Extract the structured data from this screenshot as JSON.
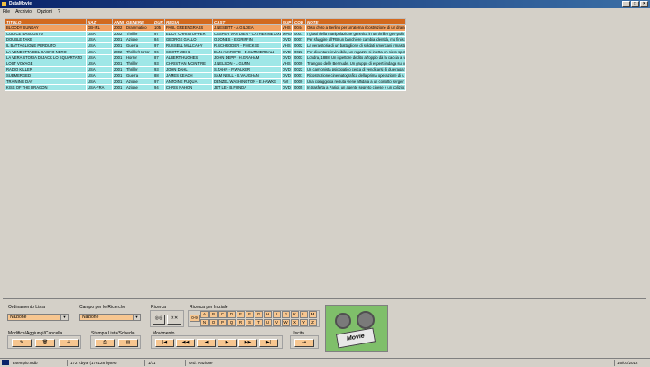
{
  "window": {
    "title": "DataMovie"
  },
  "menu": [
    "File",
    "Archivio",
    "Opzioni",
    "?"
  ],
  "grid": {
    "columns": [
      "TITOLO",
      "NAZ",
      "ANNI",
      "GENERE",
      "DUR",
      "REGIA",
      "CAST",
      "SUP",
      "COD",
      "NOTE"
    ],
    "rows": [
      [
        "BLOODY SUNDAY",
        "GB-IRL",
        "2002",
        "Drammatico",
        "105",
        "PAUL GREENGRASS",
        "J.NESBITT - A.GILDEA",
        "VHS",
        "0044",
        "Orso d'oro a Berlino per un'aterna ricostruzione di un dram"
      ],
      [
        "CODICE NASCOSTO",
        "USA",
        "2002",
        "Thriller",
        "97",
        "ELIOT CHRISTOPHER",
        "CASPER VAN DIEN - CATHERINE OXE",
        "MPEG",
        "0001",
        "I giusti della manipolazione genetica in un thriller geo-politi"
      ],
      [
        "DOUBLE TAKE",
        "USA",
        "2001",
        "Azione",
        "84",
        "GEORGE GALLO",
        "O.JONES - E.GRIFFIN",
        "DVD",
        "0007",
        "Per sfuggire all'FBI un banchiere cambia identità, ma finisco"
      ],
      [
        "IL BATTAGLIONE PERDUTO",
        "USA",
        "2001",
        "Guerra",
        "97",
        "RUSSELL MULCAHY",
        "R.SCHRODER - P.MCKEE",
        "VHS",
        "0002",
        "La vera storia di un battaglione di soldati americani rimasto"
      ],
      [
        "LA VENDETTA DEL RAGNO NERO",
        "USA",
        "2002",
        "Thriller/Horror",
        "96",
        "SCOTT ZIEHL",
        "DAN AYKROYD - D.SUMMERGALL",
        "DVD",
        "0022",
        "Per diventare invincibile, un ragazzo si inietta un siero speri"
      ],
      [
        "LA VERA STORIA DI JACK LO SQUARTATO",
        "USA",
        "2001",
        "Horror",
        "87",
        "ALBERT HUGHES",
        "JOHN DEPP - H.GRAHAM",
        "DVD",
        "0003",
        "Londra, 1888. Un ispettore dedito all'oppio dà la caccia a un"
      ],
      [
        "LOST VOYAGE",
        "USA",
        "2001",
        "Thriller",
        "93",
        "CHRISTIAN MCINTIRE",
        "J.NELSON - J.GUNN",
        "VHS",
        "0009",
        "Triangolo delle Bermude. Un gruppo di esperti indaga su un"
      ],
      [
        "RADIO KILLER",
        "USA",
        "2001",
        "Thriller",
        "93",
        "JOHN DAHL",
        "S.ZAHN - P.WALKER",
        "DVD",
        "0022",
        "Un camionista psicopatico cerca di vendicarsi di due ragaz"
      ],
      [
        "SUBMERGED",
        "USA",
        "2001",
        "Guerra",
        "88",
        "JAMES KEACH",
        "SAM NEILL - S.VAUGHAN",
        "DVD",
        "0001",
        "Ricostruzione cinematografica della prima operazione di u"
      ],
      [
        "TRAINING DAY",
        "USA",
        "2001",
        "Azione",
        "97",
        "ANTOINE FUQUA",
        "DENZEL WASHINGTON - E.HAWKE",
        "AVI",
        "0009",
        "Una coraggiosa recluta viene affidata a un corrotto sergen"
      ],
      [
        "KISS OF THE DRAGON",
        "USA-FRA",
        "2001",
        "Azione",
        "94",
        "CHRIS NAHON",
        "JET LE - B.FONDA",
        "DVD",
        "0005",
        "In trasferta a Parigi, un agente segreto cinese e un poliziot"
      ]
    ]
  },
  "controls": {
    "ordinamento_label": "Ordinamento Lista",
    "ordinamento_value": "Nazione",
    "campo_label": "Campo per le Ricerche",
    "campo_value": "Nazione",
    "ricerca_label": "Ricerca",
    "ricerca_iniziale_label": "Ricerca per Iniziale",
    "range_label": "0-9",
    "letters": [
      "A",
      "B",
      "C",
      "D",
      "E",
      "F",
      "G",
      "H",
      "I",
      "J",
      "K",
      "L",
      "M",
      "N",
      "O",
      "P",
      "Q",
      "R",
      "S",
      "T",
      "U",
      "V",
      "W",
      "X",
      "Y",
      "Z"
    ],
    "modifica_label": "Modifica/Aggiungi/Cancella",
    "stampa_label": "Stampa Lista/Scheda",
    "movimento_label": "Movimento",
    "uscita_label": "Uscita",
    "logo_text": "Movie"
  },
  "status": {
    "file": "Esempio.mdb",
    "size": "172 Kbyte  (176128 bytes)",
    "record": "1/11",
    "order": "Ord. Nazione",
    "date": "16/07/2012"
  }
}
